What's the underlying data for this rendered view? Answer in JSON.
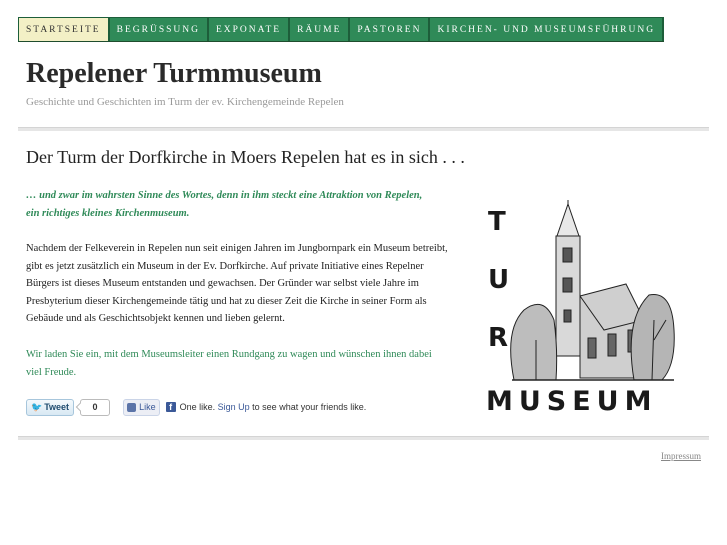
{
  "nav": {
    "items": [
      {
        "label": "STARTSEITE",
        "active": true
      },
      {
        "label": "BEGRÜSSUNG",
        "active": false
      },
      {
        "label": "EXPONATE",
        "active": false
      },
      {
        "label": "RÄUME",
        "active": false
      },
      {
        "label": "PASTOREN",
        "active": false
      },
      {
        "label": "KIRCHEN- UND MUSEUMSFÜHRUNG",
        "active": false
      }
    ]
  },
  "site": {
    "title": "Repelener Turmmuseum",
    "subtitle": "Geschichte und Geschichten im Turm der ev. Kirchengemeinde Repelen"
  },
  "post": {
    "title": "Der Turm der Dorfkirche in Moers Repelen hat es in sich . . .",
    "intro": "… und zwar im wahrsten Sinne des Wortes, denn in ihm steckt eine Attraktion von Repelen, ein richtiges kleines Kirchenmuseum.",
    "body": "Nachdem der Felkeverein in Repelen nun seit einigen Jahren im Jungbornpark ein Museum betreibt, gibt es jetzt zusätzlich ein Museum in der Ev. Dorfkirche. Auf private Initiative eines Repelner Bürgers ist dieses Museum entstanden und gewachsen. Der Gründer war selbst viele Jahre im Presbyterium dieser Kirchengemeinde tätig und hat zu dieser Zeit die Kirche in seiner Form als Gebäude und als Geschichtsobjekt kennen und lieben  gelernt.",
    "invite": "Wir laden Sie ein, mit dem Museumsleiter einen Rundgang zu wagen und wünschen ihnen dabei viel Freude."
  },
  "social": {
    "tweet_label": "Tweet",
    "tweet_count": "0",
    "like_label": "Like",
    "fb_text_before": "One like.",
    "fb_signup": "Sign Up",
    "fb_text_after": "to see what your friends like."
  },
  "logo": {
    "letters": [
      "T",
      "U",
      "R"
    ],
    "word": "MUSEUM"
  },
  "footer": {
    "impressum": "Impressum"
  }
}
